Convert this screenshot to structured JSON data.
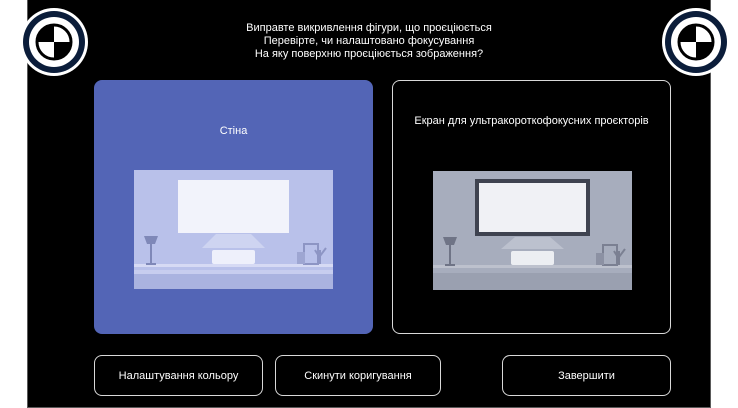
{
  "header": {
    "line1": "Виправте викривлення фігури, що проєціюється",
    "line2": "Перевірте, чи налаштовано фокусування",
    "line3": "На яку поверхню проєціюється зображення?"
  },
  "options": {
    "wall": {
      "label": "Стіна",
      "selected": true
    },
    "ust_screen": {
      "label": "Екран для ультракороткофокусних проєкторів",
      "selected": false
    }
  },
  "buttons": {
    "color": "Налаштування кольору",
    "reset": "Скинути коригування",
    "finish": "Завершити"
  },
  "icons": {
    "left_target": "focus-target-icon",
    "right_target": "focus-target-icon"
  },
  "colors": {
    "selected_card": "#5365b6",
    "background": "#000000",
    "border": "#d9d9d9"
  }
}
